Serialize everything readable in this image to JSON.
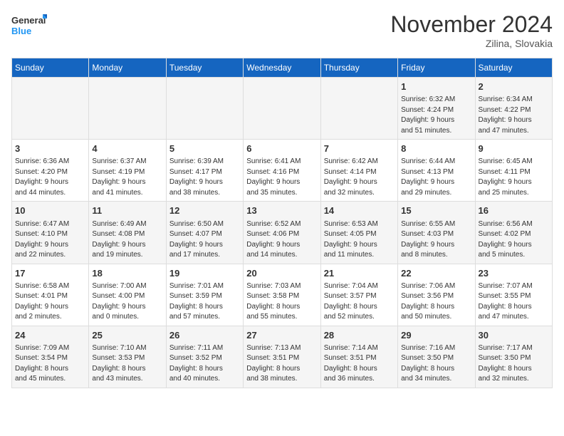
{
  "logo": {
    "line1": "General",
    "line2": "Blue"
  },
  "title": "November 2024",
  "location": "Zilina, Slovakia",
  "days_of_week": [
    "Sunday",
    "Monday",
    "Tuesday",
    "Wednesday",
    "Thursday",
    "Friday",
    "Saturday"
  ],
  "weeks": [
    [
      {
        "day": "",
        "info": ""
      },
      {
        "day": "",
        "info": ""
      },
      {
        "day": "",
        "info": ""
      },
      {
        "day": "",
        "info": ""
      },
      {
        "day": "",
        "info": ""
      },
      {
        "day": "1",
        "info": "Sunrise: 6:32 AM\nSunset: 4:24 PM\nDaylight: 9 hours\nand 51 minutes."
      },
      {
        "day": "2",
        "info": "Sunrise: 6:34 AM\nSunset: 4:22 PM\nDaylight: 9 hours\nand 47 minutes."
      }
    ],
    [
      {
        "day": "3",
        "info": "Sunrise: 6:36 AM\nSunset: 4:20 PM\nDaylight: 9 hours\nand 44 minutes."
      },
      {
        "day": "4",
        "info": "Sunrise: 6:37 AM\nSunset: 4:19 PM\nDaylight: 9 hours\nand 41 minutes."
      },
      {
        "day": "5",
        "info": "Sunrise: 6:39 AM\nSunset: 4:17 PM\nDaylight: 9 hours\nand 38 minutes."
      },
      {
        "day": "6",
        "info": "Sunrise: 6:41 AM\nSunset: 4:16 PM\nDaylight: 9 hours\nand 35 minutes."
      },
      {
        "day": "7",
        "info": "Sunrise: 6:42 AM\nSunset: 4:14 PM\nDaylight: 9 hours\nand 32 minutes."
      },
      {
        "day": "8",
        "info": "Sunrise: 6:44 AM\nSunset: 4:13 PM\nDaylight: 9 hours\nand 29 minutes."
      },
      {
        "day": "9",
        "info": "Sunrise: 6:45 AM\nSunset: 4:11 PM\nDaylight: 9 hours\nand 25 minutes."
      }
    ],
    [
      {
        "day": "10",
        "info": "Sunrise: 6:47 AM\nSunset: 4:10 PM\nDaylight: 9 hours\nand 22 minutes."
      },
      {
        "day": "11",
        "info": "Sunrise: 6:49 AM\nSunset: 4:08 PM\nDaylight: 9 hours\nand 19 minutes."
      },
      {
        "day": "12",
        "info": "Sunrise: 6:50 AM\nSunset: 4:07 PM\nDaylight: 9 hours\nand 17 minutes."
      },
      {
        "day": "13",
        "info": "Sunrise: 6:52 AM\nSunset: 4:06 PM\nDaylight: 9 hours\nand 14 minutes."
      },
      {
        "day": "14",
        "info": "Sunrise: 6:53 AM\nSunset: 4:05 PM\nDaylight: 9 hours\nand 11 minutes."
      },
      {
        "day": "15",
        "info": "Sunrise: 6:55 AM\nSunset: 4:03 PM\nDaylight: 9 hours\nand 8 minutes."
      },
      {
        "day": "16",
        "info": "Sunrise: 6:56 AM\nSunset: 4:02 PM\nDaylight: 9 hours\nand 5 minutes."
      }
    ],
    [
      {
        "day": "17",
        "info": "Sunrise: 6:58 AM\nSunset: 4:01 PM\nDaylight: 9 hours\nand 2 minutes."
      },
      {
        "day": "18",
        "info": "Sunrise: 7:00 AM\nSunset: 4:00 PM\nDaylight: 9 hours\nand 0 minutes."
      },
      {
        "day": "19",
        "info": "Sunrise: 7:01 AM\nSunset: 3:59 PM\nDaylight: 8 hours\nand 57 minutes."
      },
      {
        "day": "20",
        "info": "Sunrise: 7:03 AM\nSunset: 3:58 PM\nDaylight: 8 hours\nand 55 minutes."
      },
      {
        "day": "21",
        "info": "Sunrise: 7:04 AM\nSunset: 3:57 PM\nDaylight: 8 hours\nand 52 minutes."
      },
      {
        "day": "22",
        "info": "Sunrise: 7:06 AM\nSunset: 3:56 PM\nDaylight: 8 hours\nand 50 minutes."
      },
      {
        "day": "23",
        "info": "Sunrise: 7:07 AM\nSunset: 3:55 PM\nDaylight: 8 hours\nand 47 minutes."
      }
    ],
    [
      {
        "day": "24",
        "info": "Sunrise: 7:09 AM\nSunset: 3:54 PM\nDaylight: 8 hours\nand 45 minutes."
      },
      {
        "day": "25",
        "info": "Sunrise: 7:10 AM\nSunset: 3:53 PM\nDaylight: 8 hours\nand 43 minutes."
      },
      {
        "day": "26",
        "info": "Sunrise: 7:11 AM\nSunset: 3:52 PM\nDaylight: 8 hours\nand 40 minutes."
      },
      {
        "day": "27",
        "info": "Sunrise: 7:13 AM\nSunset: 3:51 PM\nDaylight: 8 hours\nand 38 minutes."
      },
      {
        "day": "28",
        "info": "Sunrise: 7:14 AM\nSunset: 3:51 PM\nDaylight: 8 hours\nand 36 minutes."
      },
      {
        "day": "29",
        "info": "Sunrise: 7:16 AM\nSunset: 3:50 PM\nDaylight: 8 hours\nand 34 minutes."
      },
      {
        "day": "30",
        "info": "Sunrise: 7:17 AM\nSunset: 3:50 PM\nDaylight: 8 hours\nand 32 minutes."
      }
    ]
  ]
}
